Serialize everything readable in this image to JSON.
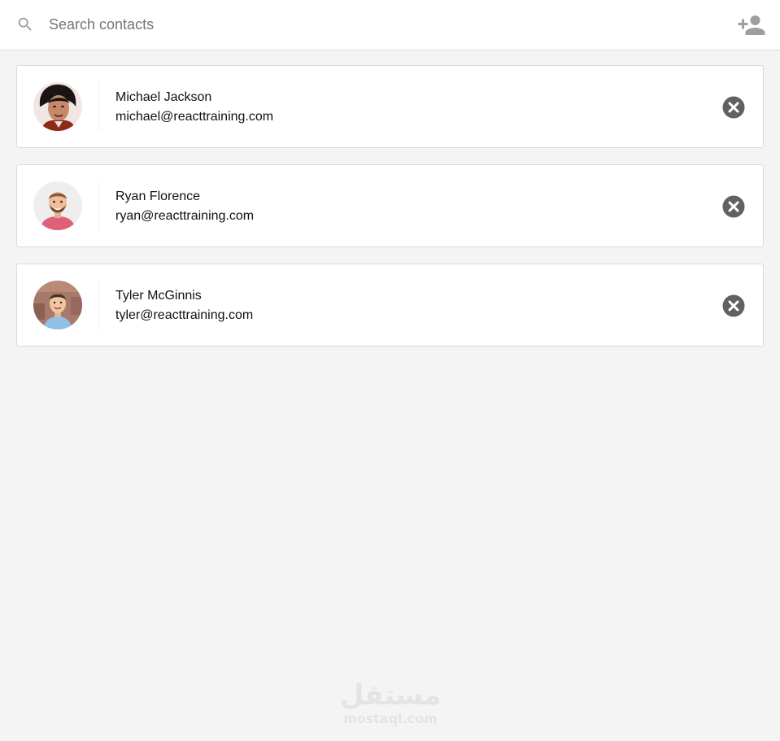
{
  "search": {
    "placeholder": "Search contacts",
    "value": ""
  },
  "icons": {
    "search": "search-icon",
    "add_contact": "person-add-icon",
    "remove": "cancel-circle-icon"
  },
  "colors": {
    "icon_gray": "#9e9e9e",
    "remove_icon": "#616161",
    "background": "#f4f4f4",
    "card": "#ffffff"
  },
  "contacts": [
    {
      "name": "Michael Jackson",
      "email": "michael@reacttraining.com"
    },
    {
      "name": "Ryan Florence",
      "email": "ryan@reacttraining.com"
    },
    {
      "name": "Tyler McGinnis",
      "email": "tyler@reacttraining.com"
    }
  ],
  "watermark": {
    "arabic": "مستقل",
    "latin": "mostaql.com"
  }
}
